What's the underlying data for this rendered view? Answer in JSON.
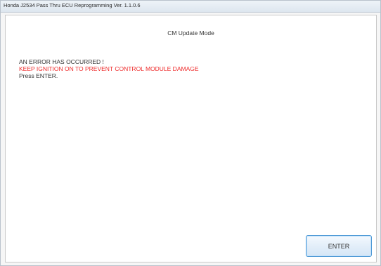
{
  "window": {
    "title": "Honda J2534 Pass Thru ECU Reprogramming Ver. 1.1.0.6"
  },
  "main": {
    "mode_title": "CM Update Mode",
    "messages": {
      "error": "AN ERROR HAS OCCURRED !",
      "warning": "KEEP IGNITION ON TO PREVENT CONTROL MODULE DAMAGE",
      "instruction": "Press ENTER."
    },
    "enter_button_label": "ENTER"
  },
  "colors": {
    "warning_text": "#ee2a2a",
    "button_border": "#4f9ad6"
  }
}
